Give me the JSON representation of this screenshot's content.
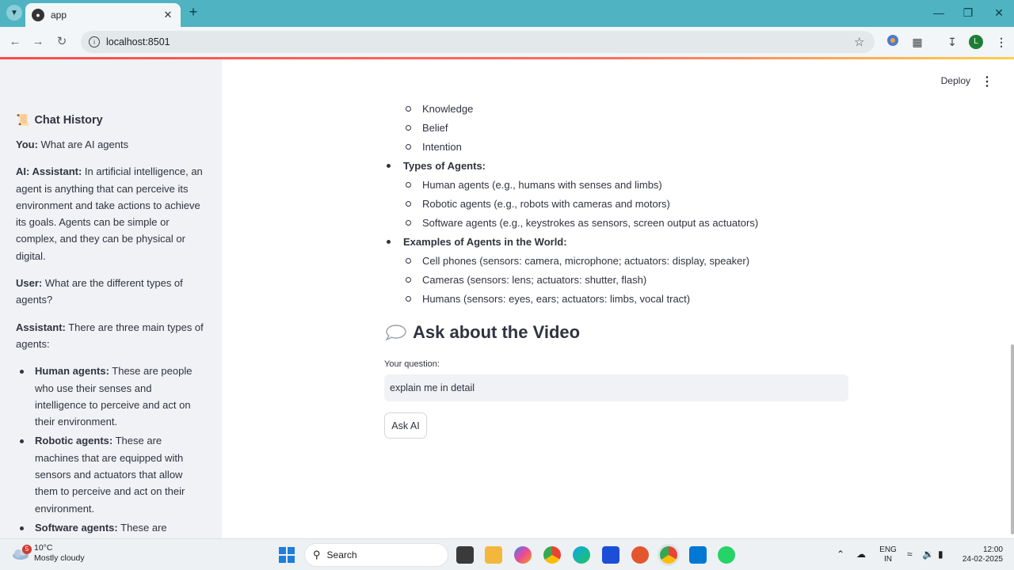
{
  "browser": {
    "tab_title": "app",
    "url": "localhost:8501",
    "profile_initial": "L"
  },
  "header": {
    "deploy_label": "Deploy"
  },
  "sidebar": {
    "title": "Chat History",
    "messages": [
      {
        "speaker": "You:",
        "text": " What are AI agents"
      },
      {
        "speaker": "AI: Assistant:",
        "text": " In artificial intelligence, an agent is anything that can perceive its environment and take actions to achieve its goals. Agents can be simple or complex, and they can be physical or digital."
      },
      {
        "speaker": "User:",
        "text": " What are the different types of agents?"
      },
      {
        "speaker": "Assistant:",
        "text": " There are three main types of agents:"
      }
    ],
    "agent_types": [
      {
        "name": "Human agents:",
        "text": " These are people who use their senses and intelligence to perceive and act on their environment."
      },
      {
        "name": "Robotic agents:",
        "text": " These are machines that are equipped with sensors and actuators that allow them to perceive and act on their environment."
      },
      {
        "name": "Software agents:",
        "text": " These are computer programs that are designed to"
      }
    ]
  },
  "main": {
    "bdi_items": [
      "Knowledge",
      "Belief",
      "Intention"
    ],
    "types_heading": "Types of Agents:",
    "types_items": [
      "Human agents (e.g., humans with senses and limbs)",
      "Robotic agents (e.g., robots with cameras and motors)",
      "Software agents (e.g., keystrokes as sensors, screen output as actuators)"
    ],
    "examples_heading": "Examples of Agents in the World:",
    "examples_items": [
      "Cell phones (sensors: camera, microphone; actuators: display, speaker)",
      "Cameras (sensors: lens; actuators: shutter, flash)",
      "Humans (sensors: eyes, ears; actuators: limbs, vocal tract)"
    ],
    "ask_heading": "Ask about the Video",
    "question_label": "Your question:",
    "question_value": "explain me in detail",
    "ask_button": "Ask AI"
  },
  "taskbar": {
    "weather_badge": "5",
    "temperature": "10°C",
    "weather_desc": "Mostly cloudy",
    "search_label": "Search",
    "lang_line1": "ENG",
    "lang_line2": "IN",
    "time": "12:00",
    "date": "24-02-2025"
  },
  "colors": {
    "tabstrip": "#4fb3c2",
    "sidebar_bg": "#f0f2f6",
    "accent": "#ff4b4b"
  }
}
